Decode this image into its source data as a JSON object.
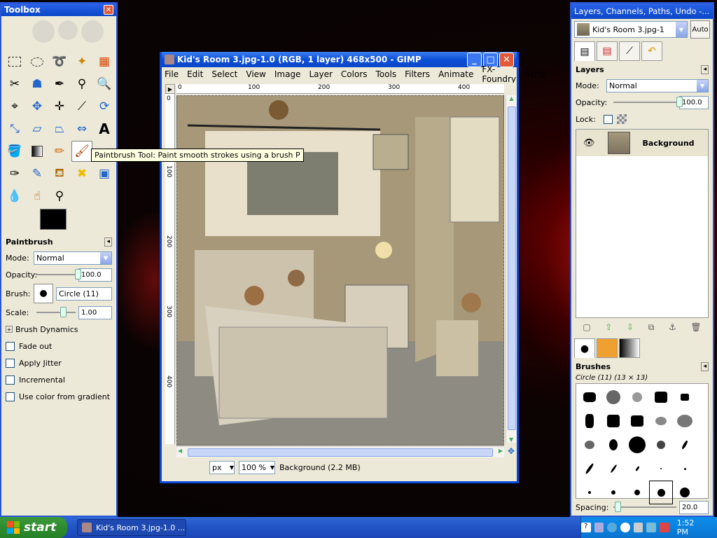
{
  "toolbox": {
    "title": "Toolbox",
    "options_title": "Paintbrush",
    "mode_label": "Mode:",
    "mode_value": "Normal",
    "opacity_label": "Opacity:",
    "opacity_value": "100.0",
    "brush_label": "Brush:",
    "brush_value": "Circle (11)",
    "scale_label": "Scale:",
    "scale_value": "1.00",
    "brush_dynamics": "Brush Dynamics",
    "checkboxes": [
      "Fade out",
      "Apply Jitter",
      "Incremental",
      "Use color from gradient"
    ]
  },
  "tooltip": "Paintbrush Tool: Paint smooth strokes using a brush  P",
  "image_window": {
    "title": "Kid's Room 3.jpg-1.0 (RGB, 1 layer) 468x500 - GIMP",
    "menu": [
      "File",
      "Edit",
      "Select",
      "View",
      "Image",
      "Layer",
      "Colors",
      "Tools",
      "Filters",
      "Animate",
      "FX-Foundry",
      "Scrip"
    ],
    "ruler_h": [
      "0",
      "100",
      "200",
      "300",
      "400"
    ],
    "ruler_v": [
      "0",
      "100",
      "200",
      "300",
      "400"
    ],
    "unit": "px",
    "zoom": "100 %",
    "status": "Background (2.2 MB)"
  },
  "dock": {
    "title": "Layers, Channels, Paths, Undo -...",
    "image_combo": "Kid's Room 3.jpg-1",
    "auto_button": "Auto",
    "layers_title": "Layers",
    "mode_label": "Mode:",
    "mode_value": "Normal",
    "opacity_label": "Opacity:",
    "opacity_value": "100.0",
    "lock_label": "Lock:",
    "layer_name": "Background",
    "brushes_title": "Brushes",
    "brush_info": "Circle (11) (13 × 13)",
    "spacing_label": "Spacing:",
    "spacing_value": "20.0"
  },
  "taskbar": {
    "start_label": "start",
    "task_label": "Kid's Room 3.jpg-1.0 ...",
    "clock": "1:52 PM"
  },
  "colors": {
    "xp_blue": "#0a46c8",
    "panel_bg": "#ece9d8",
    "start_green": "#2e8a2e"
  }
}
